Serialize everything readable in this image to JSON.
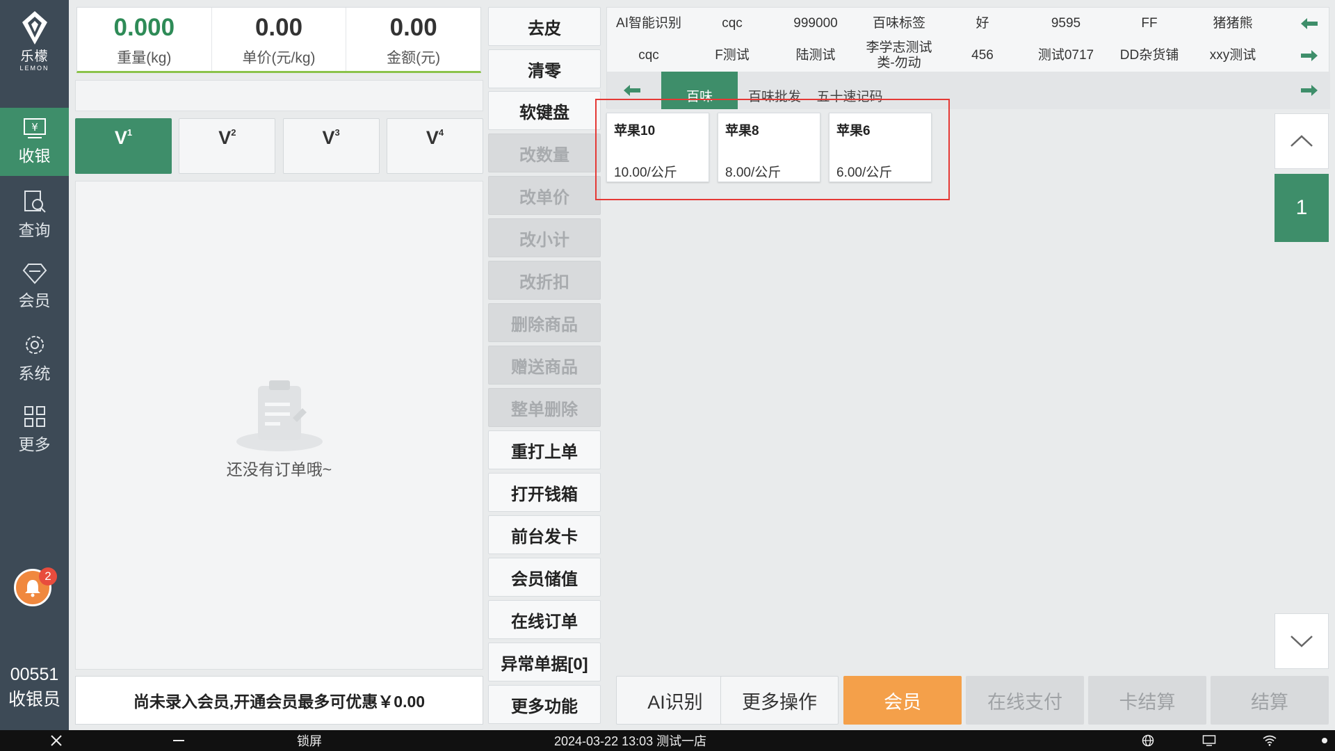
{
  "brand": {
    "name_cn": "乐檬",
    "name_en": "LEMON"
  },
  "nav": [
    {
      "label": "收银",
      "icon": "cashier-icon",
      "active": true
    },
    {
      "label": "查询",
      "icon": "query-icon"
    },
    {
      "label": "会员",
      "icon": "member-icon"
    },
    {
      "label": "系统",
      "icon": "gear-icon"
    },
    {
      "label": "更多",
      "icon": "grid-icon"
    }
  ],
  "notifications": {
    "count": "2"
  },
  "user": {
    "id": "00551",
    "role": "收银员"
  },
  "stats": {
    "weight": {
      "value": "0.000",
      "label": "重量(kg)"
    },
    "unit_price": {
      "value": "0.00",
      "label": "单价(元/kg)"
    },
    "amount": {
      "value": "0.00",
      "label": "金额(元)"
    }
  },
  "vtabs": [
    {
      "main": "V",
      "sub": "1"
    },
    {
      "main": "V",
      "sub": "2"
    },
    {
      "main": "V",
      "sub": "3"
    },
    {
      "main": "V",
      "sub": "4"
    }
  ],
  "orders": {
    "empty_text": "还没有订单哦~"
  },
  "member_tip": "尚未录入会员,开通会员最多可优惠￥0.00",
  "operations": [
    {
      "label": "去皮",
      "enabled": true
    },
    {
      "label": "清零",
      "enabled": true
    },
    {
      "label": "软键盘",
      "enabled": true
    },
    {
      "label": "改数量",
      "enabled": false
    },
    {
      "label": "改单价",
      "enabled": false
    },
    {
      "label": "改小计",
      "enabled": false
    },
    {
      "label": "改折扣",
      "enabled": false
    },
    {
      "label": "删除商品",
      "enabled": false
    },
    {
      "label": "赠送商品",
      "enabled": false
    },
    {
      "label": "整单删除",
      "enabled": false
    },
    {
      "label": "重打上单",
      "enabled": true
    },
    {
      "label": "打开钱箱",
      "enabled": true
    },
    {
      "label": "前台发卡",
      "enabled": true
    },
    {
      "label": "会员储值",
      "enabled": true
    },
    {
      "label": "在线订单",
      "enabled": true
    },
    {
      "label": "异常单据[0]",
      "enabled": true
    },
    {
      "label": "更多功能",
      "enabled": true
    }
  ],
  "categories_row1": [
    "AI智能识别",
    "cqc",
    "999000",
    "百味标签",
    "好",
    "9595",
    "FF",
    "猪猪熊"
  ],
  "categories_row2": [
    "cqc",
    "F测试",
    "陆测试",
    "李学志测试类-勿动",
    "456",
    "测试0717",
    "DD杂货铺",
    "xxy测试"
  ],
  "subcategories": [
    {
      "label": "百味",
      "active": true
    },
    {
      "label": "百味批发"
    },
    {
      "label": "五十速记码"
    }
  ],
  "products": [
    {
      "name": "苹果10",
      "price": "10.00/公斤"
    },
    {
      "name": "苹果8",
      "price": "8.00/公斤"
    },
    {
      "name": "苹果6",
      "price": "6.00/公斤"
    }
  ],
  "pagination": {
    "current": "1"
  },
  "bottom_buttons": [
    {
      "label": "AI识别",
      "style": "light"
    },
    {
      "label": "更多操作",
      "style": "light"
    },
    {
      "label": "会员",
      "style": "orange"
    },
    {
      "label": "在线支付",
      "style": "disabled"
    },
    {
      "label": "卡结算",
      "style": "disabled"
    },
    {
      "label": "结算",
      "style": "disabled"
    }
  ],
  "taskbar": {
    "lock": "锁屏",
    "datetime_store": "2024-03-22 13:03 测试一店"
  },
  "colors": {
    "primary": "#3e8e6a",
    "sidebar": "#3d4a56",
    "accent": "#f4a04a",
    "highlight": "#e53935"
  }
}
